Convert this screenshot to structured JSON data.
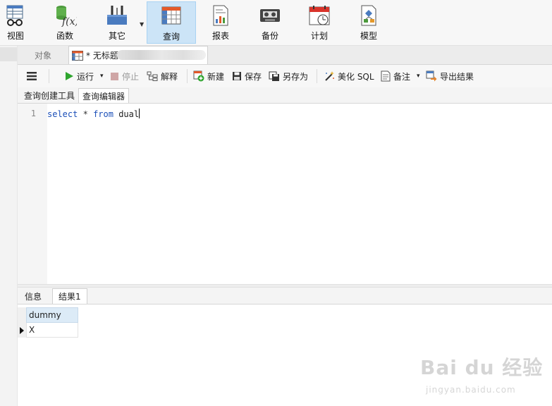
{
  "ribbon": {
    "items": [
      {
        "label": "视图",
        "icon": "view-icon"
      },
      {
        "label": "函数",
        "icon": "function-icon"
      },
      {
        "label": "其它",
        "icon": "other-tools-icon"
      },
      {
        "label": "查询",
        "icon": "query-icon",
        "active": true
      },
      {
        "label": "报表",
        "icon": "report-icon"
      },
      {
        "label": "备份",
        "icon": "backup-icon"
      },
      {
        "label": "计划",
        "icon": "schedule-icon"
      },
      {
        "label": "模型",
        "icon": "model-icon"
      }
    ],
    "dropdown_glyph": "▼"
  },
  "tabs": {
    "objects_label": "对象",
    "query_tab_title": "* 无标题"
  },
  "toolbar": {
    "run": "运行",
    "stop": "停止",
    "explain": "解释",
    "new": "新建",
    "save": "保存",
    "save_as": "另存为",
    "beautify": "美化 SQL",
    "notes": "备注",
    "export": "导出结果",
    "dropdown_glyph": "▾"
  },
  "subtabs": {
    "builder": "查询创建工具",
    "editor": "查询编辑器"
  },
  "editor": {
    "line_number": "1",
    "code": {
      "select": "select",
      "star": "*",
      "from": "from",
      "table": "dual"
    }
  },
  "result_tabs": {
    "info": "信息",
    "result1": "结果1"
  },
  "grid": {
    "columns": [
      "dummy"
    ],
    "rows": [
      [
        "X"
      ]
    ]
  },
  "watermark": {
    "main": "Bai du 经验",
    "sub": "jingyan.baidu.com"
  },
  "colors": {
    "keyword": "#1b4fb8",
    "active_ribbon": "#cce4f7",
    "grid_header": "#dcebf7",
    "run_green": "#2ea52e"
  }
}
